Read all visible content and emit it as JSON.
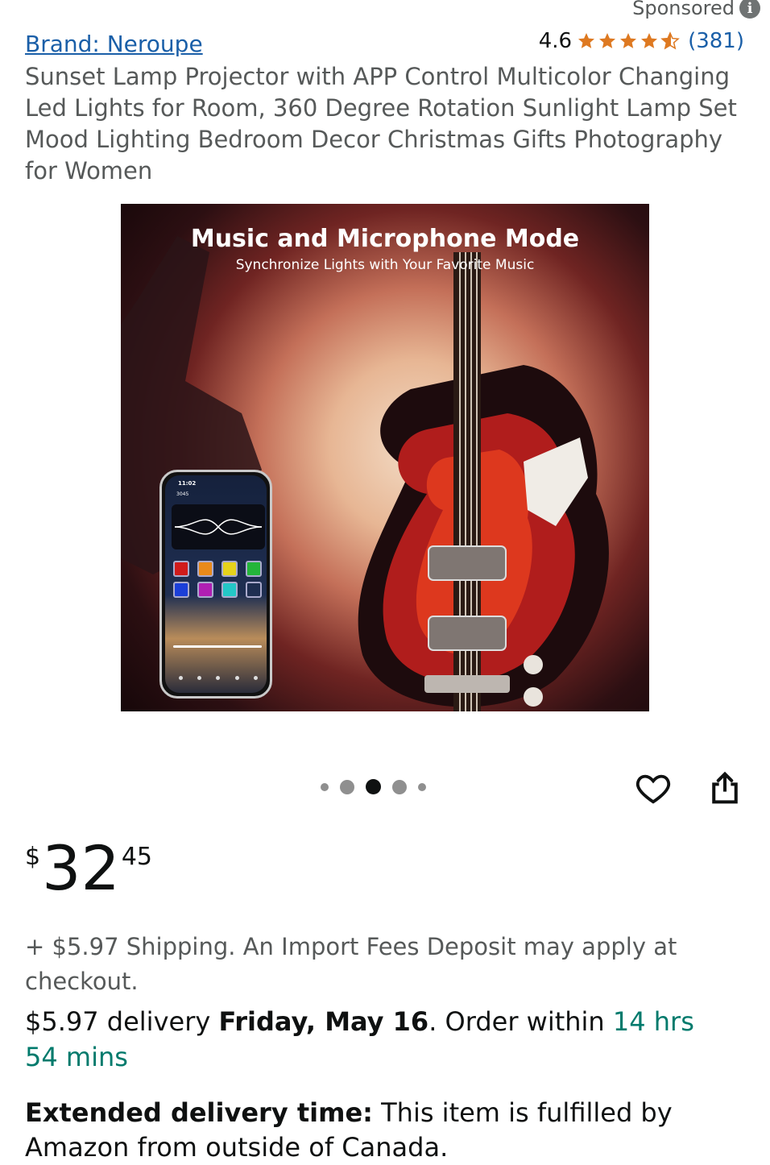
{
  "header": {
    "sponsored_label": "Sponsored",
    "info_icon": "info-icon",
    "info_glyph": "i"
  },
  "product": {
    "brand_link": "Brand: Neroupe",
    "rating_value": "4.6",
    "rating_stars": 4.6,
    "rating_count": "(381)",
    "title": "Sunset Lamp Projector with APP Control Multicolor Changing Led Lights for Room, 360 Degree Rotation Sunlight Lamp Set Mood Lighting Bedroom Decor Christmas Gifts Photography for Women"
  },
  "image": {
    "headline": "Music and Microphone Mode",
    "subheadline": "Synchronize Lights with Your Favorite Music",
    "phone_time": "11:02",
    "phone_app": "3045",
    "carousel_count": 5,
    "carousel_active": 3
  },
  "actions": {
    "favorite_icon": "heart-icon",
    "share_icon": "share-icon"
  },
  "price": {
    "symbol": "$",
    "whole": "32",
    "fraction": "45"
  },
  "shipping": {
    "text": "+ $5.97 Shipping. An Import Fees Deposit may apply at checkout."
  },
  "delivery": {
    "prefix": "$5.97 delivery ",
    "date": "Friday, May 16",
    "middle": ". Order within ",
    "countdown": "14 hrs 54 mins"
  },
  "extended": {
    "label": "Extended delivery time:",
    "text": " This item is fulfilled by Amazon from outside of Canada."
  },
  "colors": {
    "link": "#1a5fa8",
    "star": "#de7921",
    "countdown": "#007a6c"
  }
}
